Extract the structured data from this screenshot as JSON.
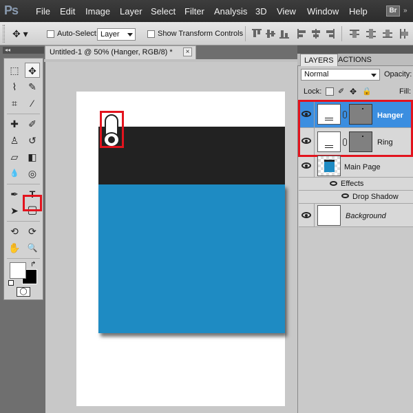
{
  "app": {
    "logo": "Ps",
    "bridge_badge": "Br",
    "menu_overflow": "»"
  },
  "menu": [
    "File",
    "Edit",
    "Image",
    "Layer",
    "Select",
    "Filter",
    "Analysis",
    "3D",
    "View",
    "Window",
    "Help"
  ],
  "options_bar": {
    "tool_icon": "move-tool-icon",
    "auto_select_label": "Auto-Select:",
    "auto_select_value": "Layer",
    "transform_label": "Show Transform Controls"
  },
  "document": {
    "tab_title": "Untitled-1 @ 50% (Hanger, RGB/8) *",
    "close_glyph": "×",
    "colors": {
      "dark_band": "#222222",
      "blue_band": "#1e8bc3",
      "canvas": "#ffffff"
    }
  },
  "toolbar": {
    "collapse_glyph": "◂◂",
    "highlight_color": "#e3131d",
    "tools": [
      {
        "name": "marquee-tool",
        "glyph": "⬚"
      },
      {
        "name": "move-tool",
        "glyph": "✥"
      },
      {
        "name": "lasso-tool",
        "glyph": "⌇"
      },
      {
        "name": "quick-selection-tool",
        "glyph": "✎"
      },
      {
        "name": "crop-tool",
        "glyph": "⌗"
      },
      {
        "name": "eyedropper-tool",
        "glyph": "⁄"
      },
      {
        "name": "healing-brush-tool",
        "glyph": "✚"
      },
      {
        "name": "brush-tool",
        "glyph": "✐"
      },
      {
        "name": "clone-stamp-tool",
        "glyph": "♙"
      },
      {
        "name": "history-brush-tool",
        "glyph": "↺"
      },
      {
        "name": "eraser-tool",
        "glyph": "▱"
      },
      {
        "name": "gradient-tool",
        "glyph": "◧"
      },
      {
        "name": "blur-tool",
        "glyph": "💧"
      },
      {
        "name": "dodge-tool",
        "glyph": "◎"
      },
      {
        "name": "pen-tool",
        "glyph": "✒"
      },
      {
        "name": "type-tool",
        "glyph": "T"
      },
      {
        "name": "path-selection-tool",
        "glyph": "➤"
      },
      {
        "name": "rounded-rectangle-tool",
        "glyph": "▢"
      },
      {
        "name": "3d-rotate-tool",
        "glyph": "⟲"
      },
      {
        "name": "3d-orbit-tool",
        "glyph": "⟳"
      },
      {
        "name": "hand-tool",
        "glyph": "✋"
      },
      {
        "name": "zoom-tool",
        "glyph": "🔍"
      }
    ],
    "quick_mask_glyph": "◯"
  },
  "layers_panel": {
    "tabs": [
      "LAYERS",
      "ACTIONS"
    ],
    "blend_mode": "Normal",
    "opacity_label": "Opacity:",
    "lock_label": "Lock:",
    "fill_label": "Fill:",
    "selection_highlight_color": "#3b8ee0",
    "layers": [
      {
        "name": "Hanger",
        "selected": true
      },
      {
        "name": "Ring",
        "selected": false
      },
      {
        "name": "Main Page",
        "selected": false
      },
      {
        "name": "Effects",
        "selected": false
      },
      {
        "name": "Drop Shadow",
        "selected": false
      },
      {
        "name": "Background",
        "selected": false
      }
    ]
  }
}
